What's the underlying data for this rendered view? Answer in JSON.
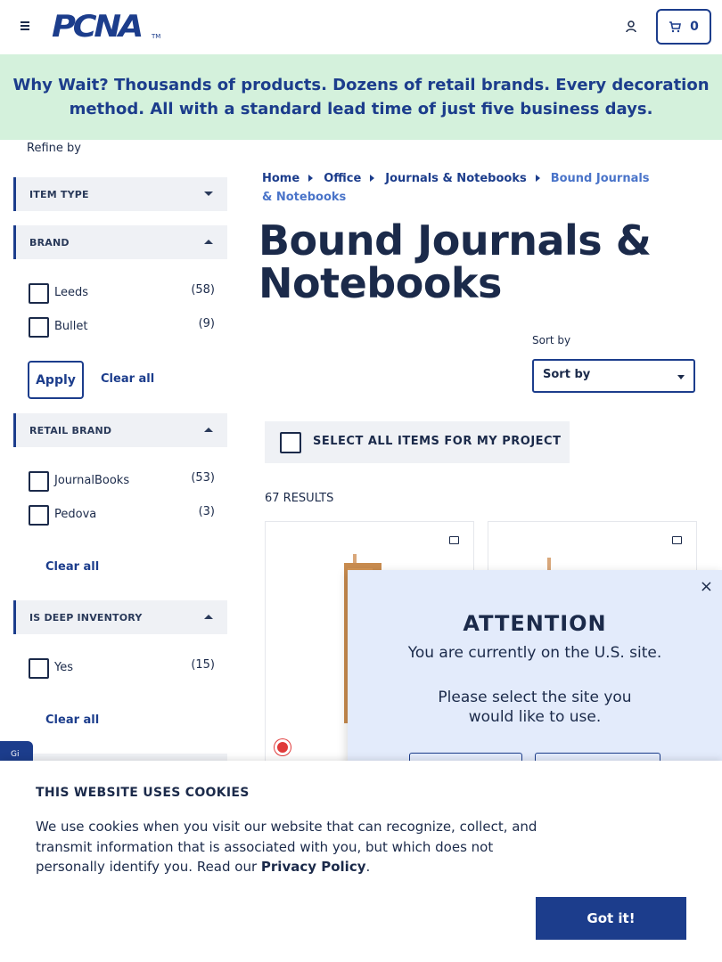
{
  "header": {
    "logo": "PCNA",
    "logo_tm": "TM",
    "cart_count": "0"
  },
  "banner": {
    "text": "Why Wait? Thousands of products. Dozens of retail brands. Every decoration method. All with a standard lead time of just five business days."
  },
  "sidebar": {
    "refine_label": "Refine by",
    "facets": {
      "item_type": {
        "title": "ITEM TYPE"
      },
      "brand": {
        "title": "BRAND",
        "options": [
          {
            "label": "Leeds",
            "count": "(58)"
          },
          {
            "label": "Bullet",
            "count": "(9)"
          }
        ],
        "apply_label": "Apply",
        "clear_label": "Clear all"
      },
      "retail_brand": {
        "title": "RETAIL BRAND",
        "options": [
          {
            "label": "JournalBooks",
            "count": "(53)"
          },
          {
            "label": "Pedova",
            "count": "(3)"
          }
        ],
        "clear_label": "Clear all"
      },
      "deep_inventory": {
        "title": "IS DEEP INVENTORY",
        "options": [
          {
            "label": "Yes",
            "count": "(15)"
          }
        ],
        "clear_label": "Clear all"
      }
    },
    "gift_tab": "Gi"
  },
  "breadcrumb": {
    "items": [
      "Home",
      "Office",
      "Journals & Notebooks"
    ],
    "current": "Bound Journals & Notebooks"
  },
  "page_title": "Bound Journals & Notebooks",
  "sort": {
    "label": "Sort by",
    "value": "Sort by"
  },
  "select_all_label": "SELECT ALL ITEMS FOR MY PROJECT",
  "results_label": "67 RESULTS",
  "modal": {
    "close": "×",
    "title": "ATTENTION",
    "line1": "You are currently on the U.S. site.",
    "line2a": "Please select the site you",
    "line2b": "would like to use."
  },
  "cookie": {
    "title": "THIS WEBSITE USES COOKIES",
    "text": "We use cookies when you visit our website that can recognize, collect, and transmit information that is associated with you, but which does not personally identify you. Read our ",
    "link": "Privacy Policy",
    "after": ".",
    "button": "Got it!"
  },
  "colors": {
    "brand": "#1c3d8c",
    "banner_bg": "#d4f1dc",
    "modal_bg": "#e3ebfb",
    "swatch": "#e03a3a"
  }
}
